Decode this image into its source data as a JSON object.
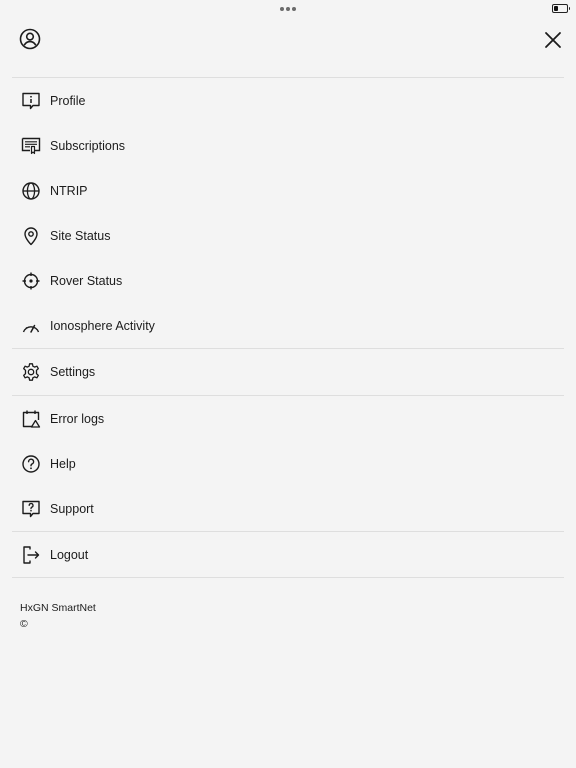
{
  "status_bar": {
    "battery_level": 0.35
  },
  "header": {
    "profile_icon": "user-circle-icon",
    "close_icon": "close-icon"
  },
  "menu": {
    "items": [
      {
        "id": "profile",
        "label": "Profile",
        "icon": "profile-info-icon"
      },
      {
        "id": "subscriptions",
        "label": "Subscriptions",
        "icon": "subscriptions-icon"
      },
      {
        "id": "ntrip",
        "label": "NTRIP",
        "icon": "globe-icon"
      },
      {
        "id": "site-status",
        "label": "Site Status",
        "icon": "location-pin-icon"
      },
      {
        "id": "rover-status",
        "label": "Rover Status",
        "icon": "crosshair-icon"
      },
      {
        "id": "ionosphere-activity",
        "label": "Ionosphere Activity",
        "icon": "gauge-icon"
      },
      {
        "id": "settings",
        "label": "Settings",
        "icon": "gear-icon"
      },
      {
        "id": "error-logs",
        "label": "Error logs",
        "icon": "calendar-warning-icon"
      },
      {
        "id": "help",
        "label": "Help",
        "icon": "question-circle-icon"
      },
      {
        "id": "support",
        "label": "Support",
        "icon": "support-question-icon"
      },
      {
        "id": "logout",
        "label": "Logout",
        "icon": "logout-icon"
      }
    ]
  },
  "footer": {
    "app_name": "HxGN SmartNet",
    "copyright": "©"
  }
}
